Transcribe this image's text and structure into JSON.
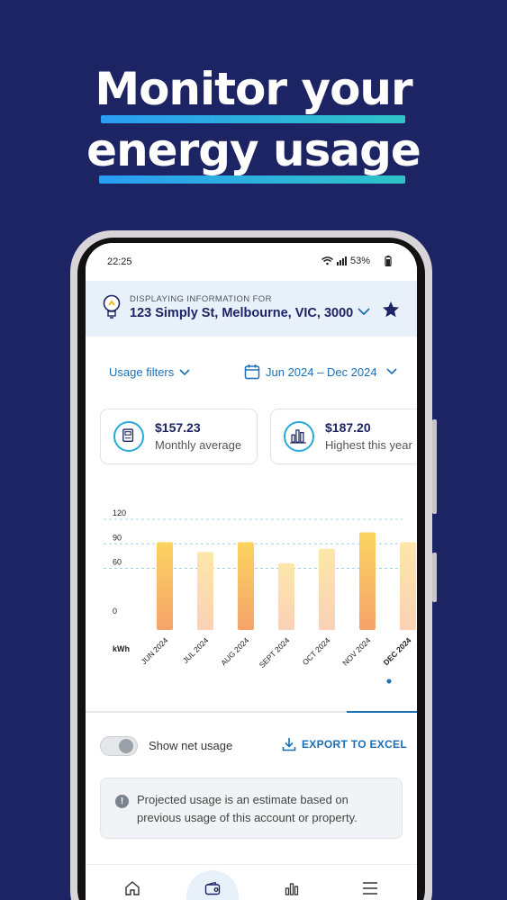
{
  "promo": {
    "line1": "Monitor your",
    "line2": "energy usage"
  },
  "status_bar": {
    "time": "22:25",
    "battery": "53%"
  },
  "header": {
    "caption": "DISPLAYING INFORMATION FOR",
    "address": "123 Simply St, Melbourne, VIC, 3000"
  },
  "filters": {
    "usage_label": "Usage filters",
    "date_range": "Jun 2024 – Dec 2024"
  },
  "cards": [
    {
      "value": "$157.23",
      "label": "Monthly average"
    },
    {
      "value": "$187.20",
      "label": "Highest this year"
    }
  ],
  "chart_data": {
    "type": "bar",
    "categories": [
      "JUN 2024",
      "JUL 2024",
      "AUG 2024",
      "SEPT 2024",
      "OCT 2024",
      "NOV 2024",
      "DEC 2024"
    ],
    "values": [
      92,
      80,
      92,
      66,
      84,
      104,
      92
    ],
    "ylabel": "kWh",
    "yticks": [
      0,
      60,
      90,
      120
    ],
    "ylim": [
      0,
      120
    ],
    "selected": "DEC 2024",
    "grid": true
  },
  "controls": {
    "net_usage_label": "Show net usage",
    "net_usage_on": false,
    "export_label": "EXPORT TO EXCEL"
  },
  "note": {
    "text": "Projected usage is an estimate based on previous usage of this account or property."
  },
  "colors": {
    "background": "#1c2463",
    "accent": "#1b6fb5",
    "bar_top": "#fbd460",
    "bar_bottom": "#f6a36a"
  }
}
